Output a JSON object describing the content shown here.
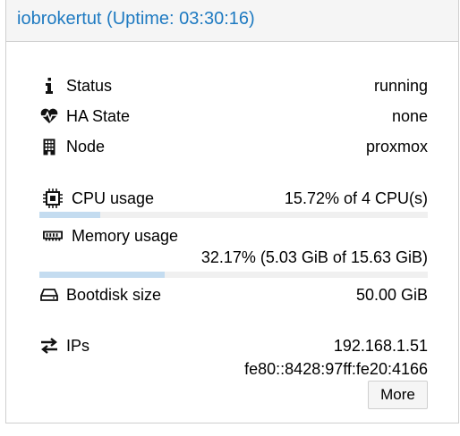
{
  "header": {
    "title": "iobrokertut (Uptime: 03:30:16)"
  },
  "rows": {
    "status": {
      "label": "Status",
      "value": "running",
      "icon": "info-icon"
    },
    "ha_state": {
      "label": "HA State",
      "value": "none",
      "icon": "heartbeat-icon"
    },
    "node": {
      "label": "Node",
      "value": "proxmox",
      "icon": "building-icon"
    },
    "cpu": {
      "label": "CPU usage",
      "value": "15.72% of 4 CPU(s)",
      "icon": "cpu-chip-icon",
      "usage_fraction": 0.1572
    },
    "memory": {
      "label": "Memory usage",
      "value": "32.17% (5.03 GiB of 15.63 GiB)",
      "icon": "memory-icon",
      "usage_fraction": 0.3217
    },
    "bootdisk": {
      "label": "Bootdisk size",
      "value": "50.00 GiB",
      "icon": "hdd-icon"
    },
    "ips": {
      "label": "IPs",
      "values": [
        "192.168.1.51",
        "fe80::8428:97ff:fe20:4166"
      ],
      "icon": "exchange-arrows-icon"
    }
  },
  "buttons": {
    "more": "More"
  },
  "colors": {
    "title": "#1e7ac1",
    "bar_fill": "#c4dcf0",
    "bar_track": "#f0f0f0",
    "header_bg": "#f5f5f5"
  }
}
